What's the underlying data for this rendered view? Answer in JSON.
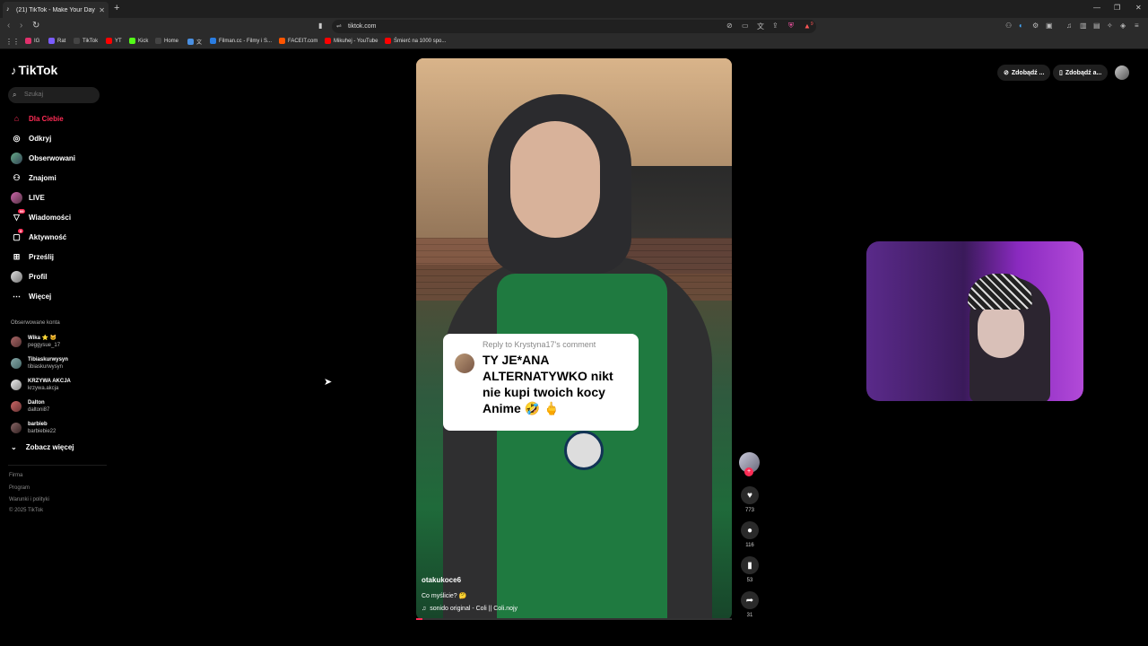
{
  "browser": {
    "tab_title": "(21) TikTok - Make Your Day",
    "tab_icon": "tiktok-icon",
    "url": "tiktok.com",
    "bookmarks": [
      {
        "label": "IG",
        "color": "#e1306c"
      },
      {
        "label": "Rat",
        "color": "#7b5cff"
      },
      {
        "label": "TikTok",
        "color": "#111111"
      },
      {
        "label": "YT",
        "color": "#ff0000"
      },
      {
        "label": "Kick",
        "color": "#53fc18"
      },
      {
        "label": "Home",
        "color": "#111111"
      },
      {
        "label": "文",
        "color": "#4a90e2"
      },
      {
        "label": "Filman.cc - Filmy i S...",
        "color": "#2a7de1"
      },
      {
        "label": "FACEIT.com",
        "color": "#ff5500"
      },
      {
        "label": "Mikuhej - YouTube",
        "color": "#ff0000"
      },
      {
        "label": "Śmierć na 1000 spo...",
        "color": "#ff0000"
      }
    ],
    "extension_badge": "9"
  },
  "sidebar": {
    "logo": "TikTok",
    "search_placeholder": "Szukaj",
    "nav": [
      {
        "label": "Dla Ciebie",
        "icon": "home-icon",
        "active": true
      },
      {
        "label": "Odkryj",
        "icon": "compass-icon"
      },
      {
        "label": "Obserwowani",
        "icon": "following-avatar-icon"
      },
      {
        "label": "Znajomi",
        "icon": "friends-icon"
      },
      {
        "label": "LIVE",
        "icon": "live-avatar-icon"
      },
      {
        "label": "Wiadomości",
        "icon": "messages-icon",
        "badge": "99"
      },
      {
        "label": "Aktywność",
        "icon": "activity-icon",
        "badge": "3"
      },
      {
        "label": "Prześlij",
        "icon": "upload-icon"
      },
      {
        "label": "Profil",
        "icon": "profile-icon"
      },
      {
        "label": "Więcej",
        "icon": "more-icon"
      }
    ],
    "followed_title": "Obserwowane konta",
    "followed": [
      {
        "name": "Wika ⭐ 🐱",
        "handle": "peggysue_17"
      },
      {
        "name": "Tibiaskurwysyn",
        "handle": "tibiaskurwysyn"
      },
      {
        "name": "KRZYWA AKCJA",
        "handle": "krzywa.akcja"
      },
      {
        "name": "Dalton",
        "handle": "daltoni87"
      },
      {
        "name": "barbieb",
        "handle": "barbiebie22"
      }
    ],
    "see_more": "Zobacz więcej",
    "footer": [
      "Firma",
      "Program",
      "Warunki i polityki",
      "© 2025 TikTok"
    ]
  },
  "video": {
    "reply_header": "Reply to Krystyna17's comment",
    "reply_text": "TY JE*ANA ALTERNATYWKO nikt nie kupi twoich kocy Anime 🤣 🖕",
    "username": "otakukoce6",
    "description": "Co myślicie? 🤔",
    "music": "sonido original - Coli || Coli.nojy",
    "progress": 0.02
  },
  "actions": {
    "likes": "773",
    "comments": "116",
    "saves": "53",
    "shares": "31"
  },
  "topright": {
    "btn1": "Zdobądź ...",
    "btn2": "Zdobądź a..."
  },
  "colors": {
    "accent": "#fe2c55",
    "bg": "#000000"
  }
}
